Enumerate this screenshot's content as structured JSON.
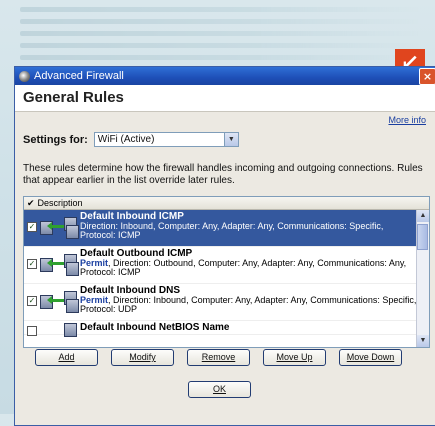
{
  "corner_badge": "↙",
  "window": {
    "title": "Advanced Firewall",
    "close": "×"
  },
  "header": {
    "title": "General Rules",
    "more_info": "More info"
  },
  "settings": {
    "label": "Settings for:",
    "value": "WiFi (Active)"
  },
  "description": "These rules determine how the firewall handles incoming and outgoing connections. Rules that appear earlier in the list override later rules.",
  "list": {
    "column_header": "Description",
    "rows": [
      {
        "title": "Default Inbound ICMP",
        "action": "",
        "details": "Direction: Inbound, Computer: Any, Adapter: Any, Communications: Specific,",
        "protocol": "Protocol: ICMP",
        "checked": true,
        "selected": true
      },
      {
        "title": "Default Outbound ICMP",
        "action": "Permit",
        "details": ", Direction: Outbound, Computer: Any, Adapter: Any, Communications: Any,",
        "protocol": "Protocol: ICMP",
        "checked": true,
        "selected": false
      },
      {
        "title": "Default Inbound DNS",
        "action": "Permit",
        "details": ", Direction: Inbound, Computer: Any, Adapter: Any, Communications: Specific,",
        "protocol": "Protocol: UDP",
        "checked": true,
        "selected": false
      },
      {
        "title": "Default Inbound NetBIOS Name",
        "action": "",
        "details": "",
        "protocol": "",
        "checked": false,
        "selected": false
      }
    ]
  },
  "buttons": {
    "add": "Add",
    "modify": "Modify",
    "remove": "Remove",
    "move_up": "Move Up",
    "move_down": "Move Down",
    "ok": "OK"
  },
  "colors": {
    "titlebar": "#1e4fb7",
    "selection": "#34589e",
    "accent": "#e0451e"
  }
}
